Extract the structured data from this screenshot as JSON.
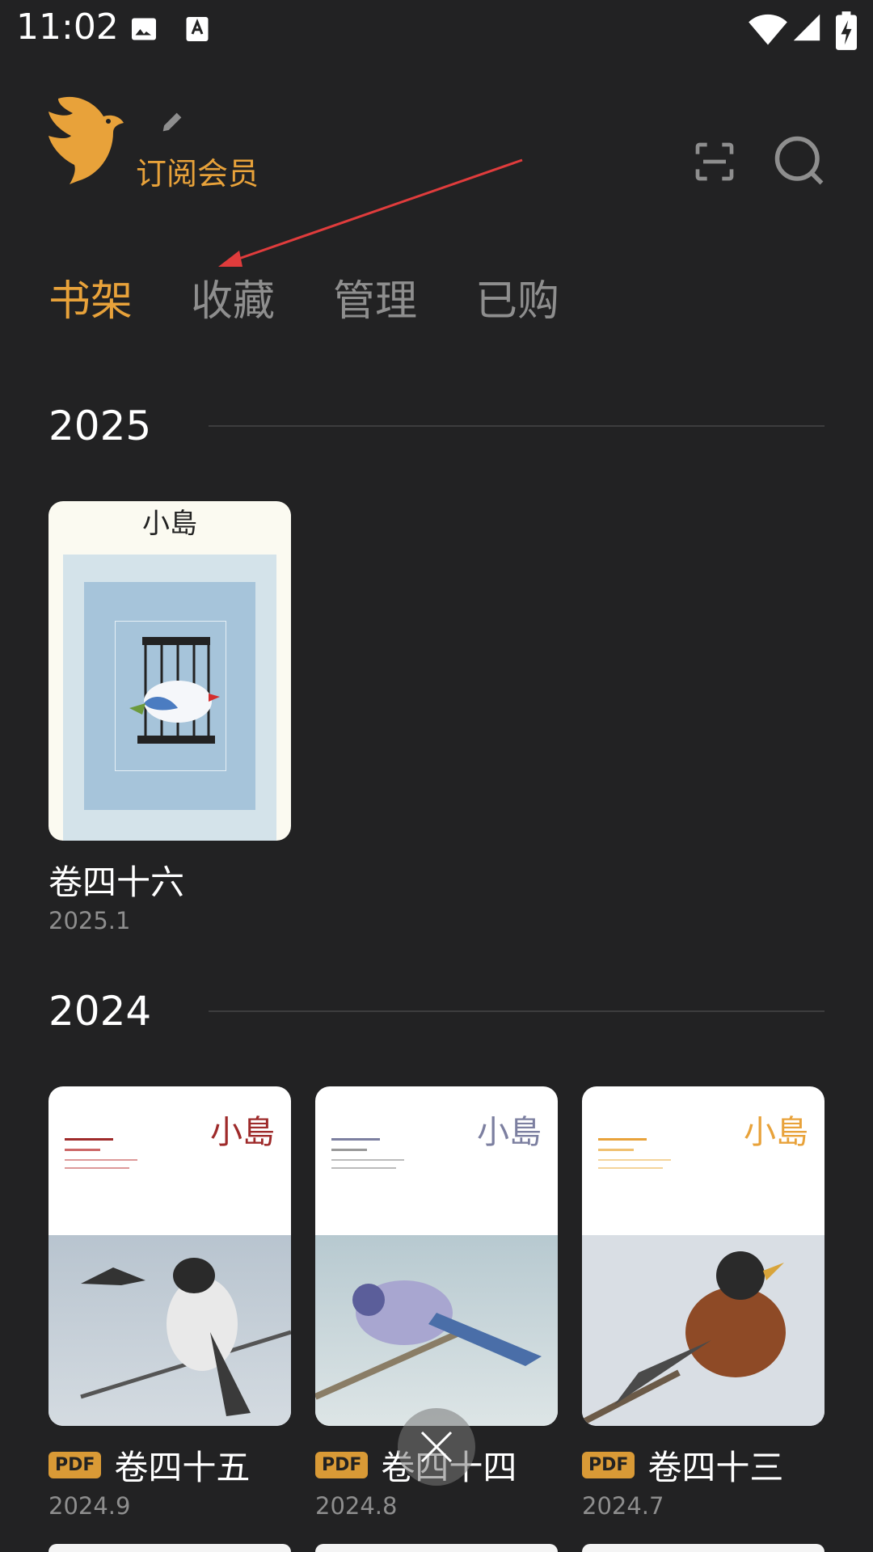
{
  "status": {
    "time": "11:02",
    "icons": [
      "image-icon",
      "text-a-icon",
      "wifi-icon",
      "signal-icon",
      "battery-charging-icon"
    ]
  },
  "header": {
    "logo": "bird-logo-icon",
    "member_label": "订阅会员",
    "edit_icon": "pencil-icon",
    "scan_icon": "scan-icon",
    "search_icon": "search-icon",
    "accent_color": "#E8A23A"
  },
  "tabs": [
    {
      "label": "书架",
      "active": true
    },
    {
      "label": "收藏",
      "active": false
    },
    {
      "label": "管理",
      "active": false
    },
    {
      "label": "已购",
      "active": false
    }
  ],
  "sections": [
    {
      "year": "2025",
      "books": [
        {
          "title": "卷四十六",
          "date": "2025.1",
          "pdf": false,
          "cover_text": "小島"
        }
      ]
    },
    {
      "year": "2024",
      "books": [
        {
          "title": "卷四十五",
          "date": "2024.9",
          "pdf": true,
          "badge": "PDF",
          "cover_text": "小島"
        },
        {
          "title": "卷四十四",
          "date": "2024.8",
          "pdf": true,
          "badge": "PDF",
          "cover_text": "小島"
        },
        {
          "title": "卷四十三",
          "date": "2024.7",
          "pdf": true,
          "badge": "PDF",
          "cover_text": "小島"
        }
      ]
    }
  ]
}
